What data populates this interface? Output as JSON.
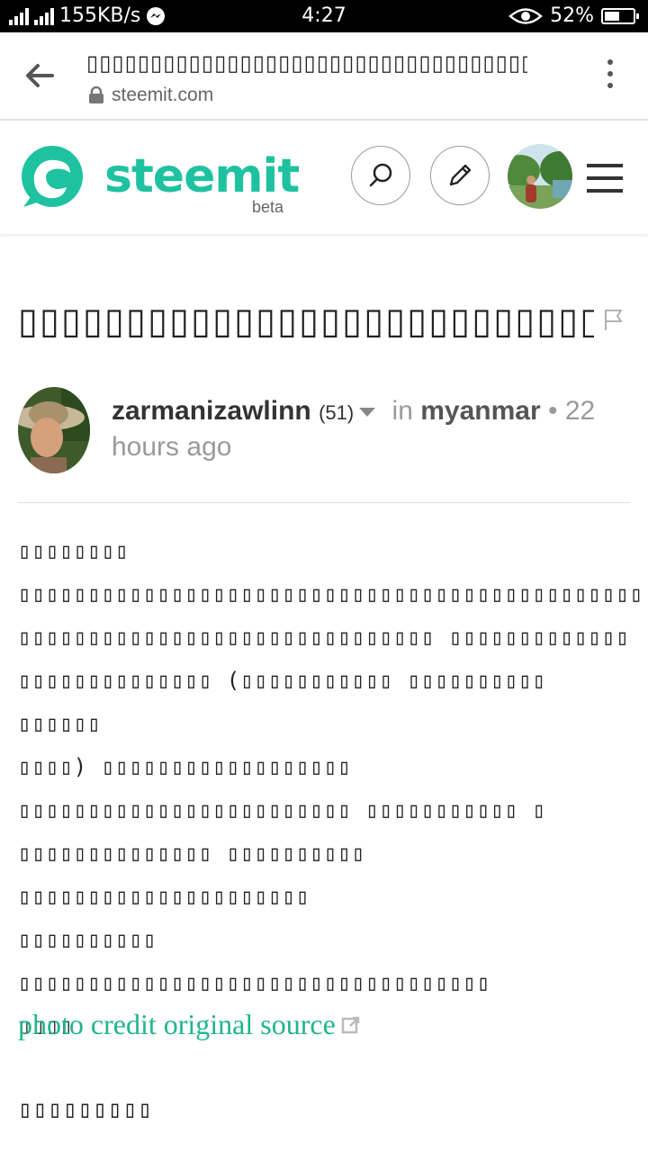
{
  "status_bar": {
    "net_speed": "155KB/s",
    "time": "4:27",
    "battery_percent": "52%",
    "battery_level": 0.52
  },
  "browser": {
    "page_title": "▯▯▯▯▯▯▯▯▯▯▯▯▯▯▯▯▯▯▯▯▯▯▯▯▯▯▯▯▯▯▯▯▯▯▯▯▯▯▯▯▯▯▯▯▯▯...",
    "domain": "steemit.com",
    "icons": {
      "back": "arrow-left-icon",
      "lock": "lock-icon",
      "menu": "more-vertical-icon"
    }
  },
  "site_header": {
    "logo_text": "steemit",
    "beta_label": "beta",
    "brand_color": "#1fc2a0",
    "icons": {
      "search": "search-icon",
      "compose": "pencil-icon",
      "menu": "hamburger-icon"
    }
  },
  "post": {
    "title": "▯▯▯▯▯▯▯▯▯▯▯▯▯▯▯▯▯▯▯▯▯▯▯▯▯▯▯▯▯",
    "author": "zarmanizawlinn",
    "reputation": "(51)",
    "in_label": "in",
    "category": "myanmar",
    "separator": "•",
    "time_ago": "22 hours ago",
    "body": [
      "▯▯▯▯▯▯▯▯",
      "▯▯▯▯▯▯▯▯▯▯▯▯▯▯▯▯▯▯▯▯▯▯▯▯▯▯▯▯▯▯▯▯▯▯▯▯▯▯▯▯▯▯▯▯▯",
      "▯▯▯▯▯▯▯▯▯▯▯▯▯▯▯▯▯▯▯▯▯▯▯▯▯▯▯▯▯▯ ▯▯▯▯▯▯▯▯▯▯▯▯▯",
      "▯▯▯▯▯▯▯▯▯▯▯▯▯▯ (▯▯▯▯▯▯▯▯▯▯▯ ▯▯▯▯▯▯▯▯▯▯ ▯▯▯▯▯▯",
      "▯▯▯▯) ▯▯▯▯▯▯▯▯▯▯▯▯▯▯▯▯▯▯",
      "▯▯▯▯▯▯▯▯▯▯▯▯▯▯▯▯▯▯▯▯▯▯▯▯ ▯▯▯▯▯▯▯▯▯▯▯ ▯",
      "▯▯▯▯▯▯▯▯▯▯▯▯▯▯ ▯▯▯▯▯▯▯▯▯▯ ▯▯▯▯▯▯▯▯▯▯▯▯▯▯▯▯▯▯▯▯▯",
      "▯▯▯▯▯▯▯▯▯▯ ▯▯▯▯▯▯▯▯▯▯▯▯▯▯▯▯▯▯▯▯▯▯▯▯▯▯▯▯▯▯▯▯▯▯",
      "▯▯▯▯"
    ],
    "photo_credit": "photo credit original source",
    "signature": "▯▯▯▯▯▯▯▯▯"
  }
}
